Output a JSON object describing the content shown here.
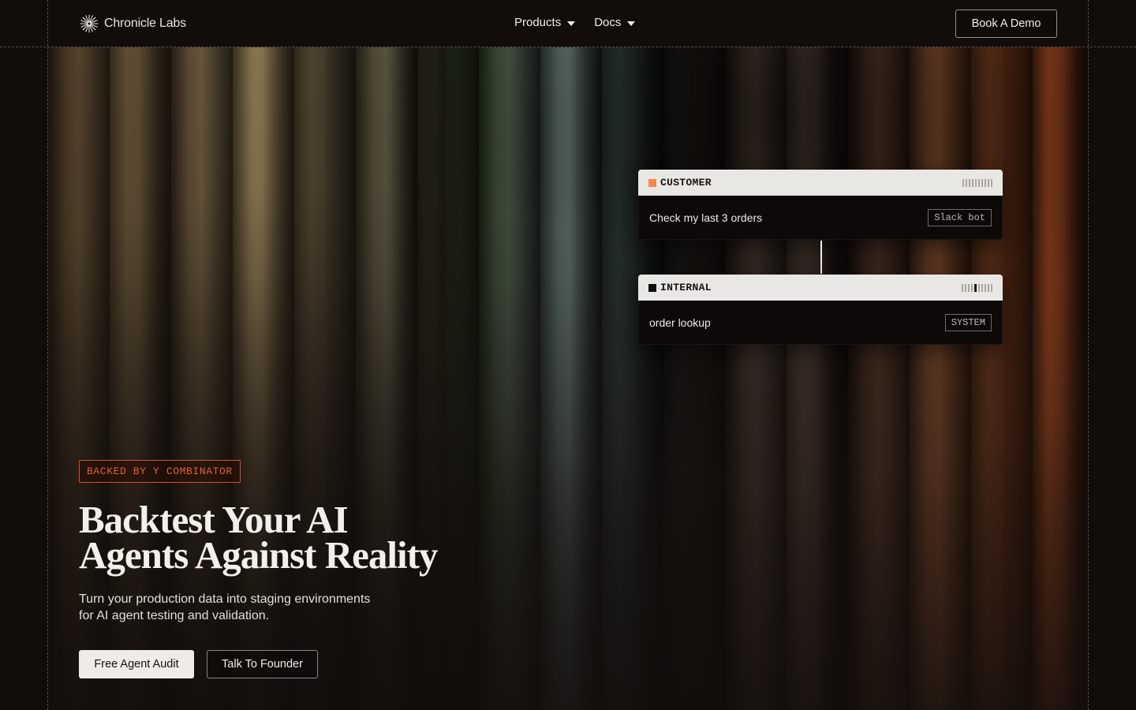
{
  "nav": {
    "logo_text": "Chronicle Labs",
    "logo_icon": "starburst-icon",
    "menu": [
      {
        "label": "Products",
        "icon": "chevron-down-icon"
      },
      {
        "label": "Docs",
        "icon": "chevron-down-icon"
      }
    ],
    "cta_label": "Book A Demo"
  },
  "cards": {
    "customer": {
      "label": "CUSTOMER",
      "accent": "#f08a4b",
      "message": "Check my last 3 orders",
      "tag": "Slack bot"
    },
    "internal": {
      "label": "INTERNAL",
      "accent": "#111111",
      "message": "order lookup",
      "tag": "SYSTEM"
    }
  },
  "hero": {
    "badge": "BACKED BY Y COMBINATOR",
    "headline_line1": "Backtest Your AI",
    "headline_line2": "Agents Against Reality",
    "subtext_line1": "Turn your production data into staging environments",
    "subtext_line2": "for AI agent testing and validation.",
    "primary_cta": "Free Agent Audit",
    "secondary_cta": "Talk To Founder"
  },
  "colors": {
    "background": "#120d0b",
    "badge_accent": "#e0612f",
    "primary_button": "#efebe7"
  }
}
